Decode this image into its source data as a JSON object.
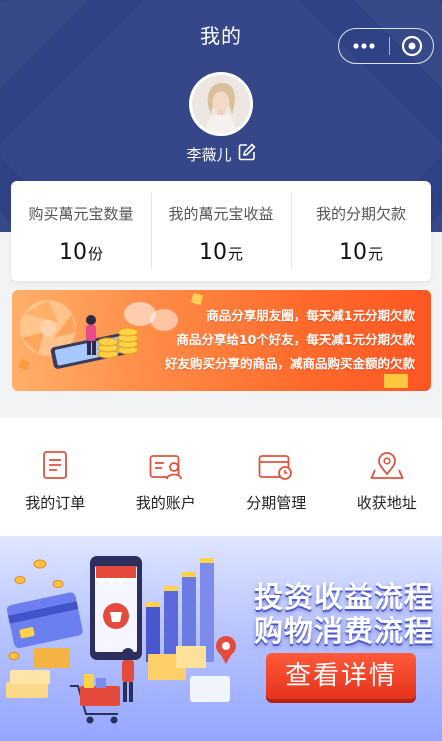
{
  "header": {
    "title": "我的",
    "capsule": {
      "more_icon": "more-dots-icon",
      "close_icon": "target-circle-icon"
    },
    "user": {
      "name": "李薇儿",
      "edit_icon": "edit-icon"
    },
    "bg_color": "#2f4285"
  },
  "stats": [
    {
      "label": "购买萬元宝数量",
      "value": "10",
      "unit": "份"
    },
    {
      "label": "我的萬元宝收益",
      "value": "10",
      "unit": "元"
    },
    {
      "label": "我的分期欠款",
      "value": "10",
      "unit": "元"
    }
  ],
  "promo": {
    "lines": [
      "商品分享朋友圈，每天减1元分期欠款",
      "商品分享给10个好友，每天减1元分期欠款",
      "好友购买分享的商品，减商品购买金额的欠款"
    ],
    "accent": "#ff6a2c"
  },
  "menu": [
    {
      "label": "我的订单",
      "icon": "order-icon"
    },
    {
      "label": "我的账户",
      "icon": "account-icon"
    },
    {
      "label": "分期管理",
      "icon": "installment-icon"
    },
    {
      "label": "收获地址",
      "icon": "location-icon"
    }
  ],
  "bottom_banner": {
    "line1": "投资收益流程",
    "line2": "购物消费流程",
    "button": "查看详情"
  },
  "colors": {
    "icon_accent": "#e0533f",
    "button_red": "#e5331c"
  }
}
